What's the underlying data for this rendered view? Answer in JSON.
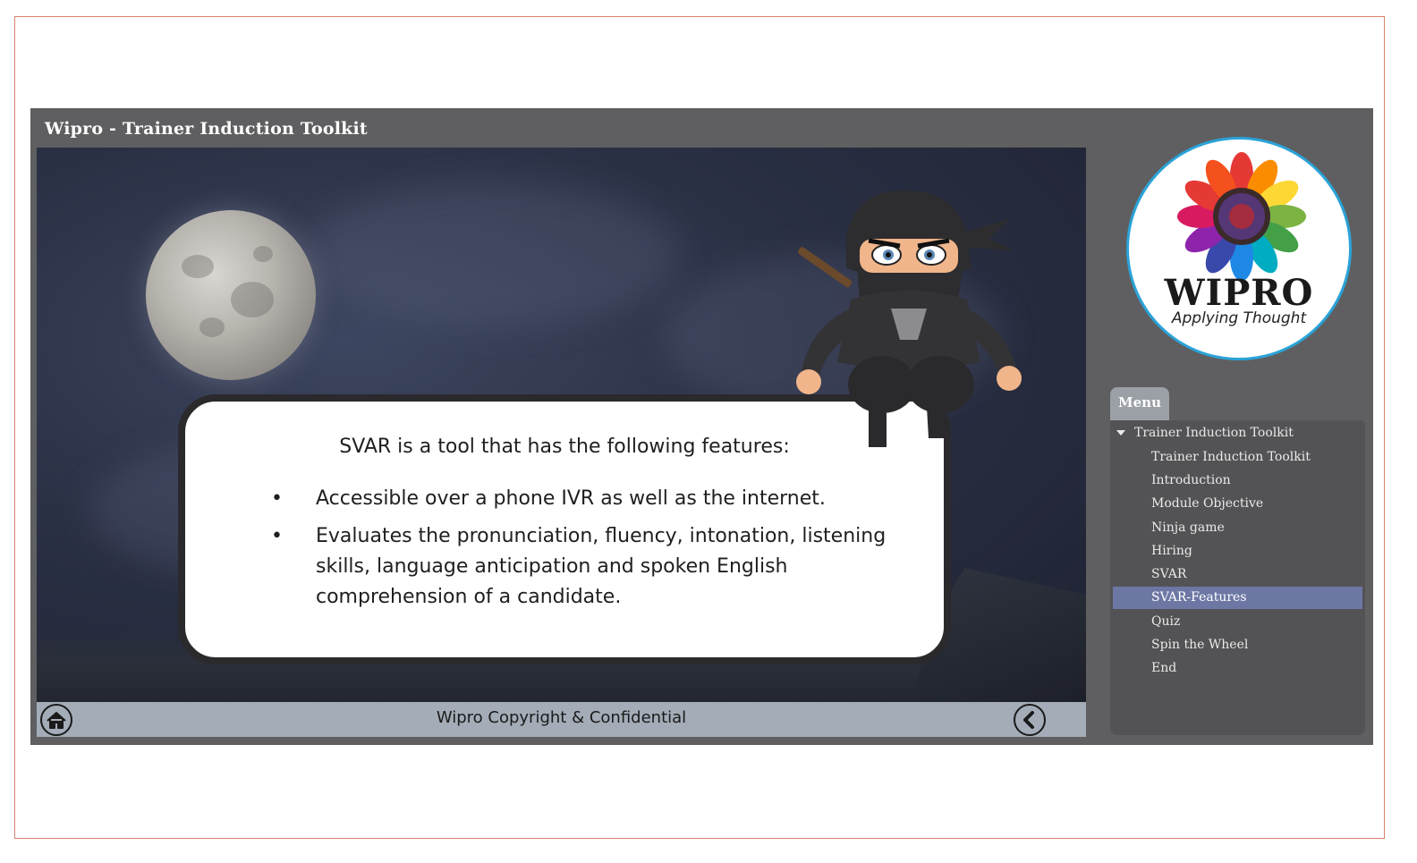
{
  "window": {
    "title": "Wipro - Trainer Induction Toolkit"
  },
  "slide": {
    "heading": "SVAR is a tool that has the following features:",
    "bullets": [
      "Accessible over a phone IVR as well as the internet.",
      "Evaluates the pronunciation, fluency, intonation, listening skills, language anticipation and spoken English comprehension of a candidate."
    ],
    "bullet_char": "•"
  },
  "footer": {
    "text": "Wipro Copyright & Confidential"
  },
  "logo": {
    "name": "WIPRO",
    "tagline": "Applying Thought"
  },
  "menu": {
    "tab_label": "Menu",
    "root": "Trainer Induction Toolkit",
    "items": [
      "Trainer Induction Toolkit",
      "Introduction",
      "Module Objective",
      "Ninja game",
      "Hiring",
      "SVAR",
      "SVAR-Features",
      "Quiz",
      "Spin the Wheel",
      "End"
    ],
    "active": "SVAR-Features"
  },
  "colors": {
    "player_bg": "#5f5f61",
    "footer_bg": "#a3acb7",
    "menu_active": "#6d77a4",
    "logo_ring": "#2aa3d8"
  },
  "icons": {
    "home": "home-icon",
    "back": "chevron-left-icon"
  }
}
